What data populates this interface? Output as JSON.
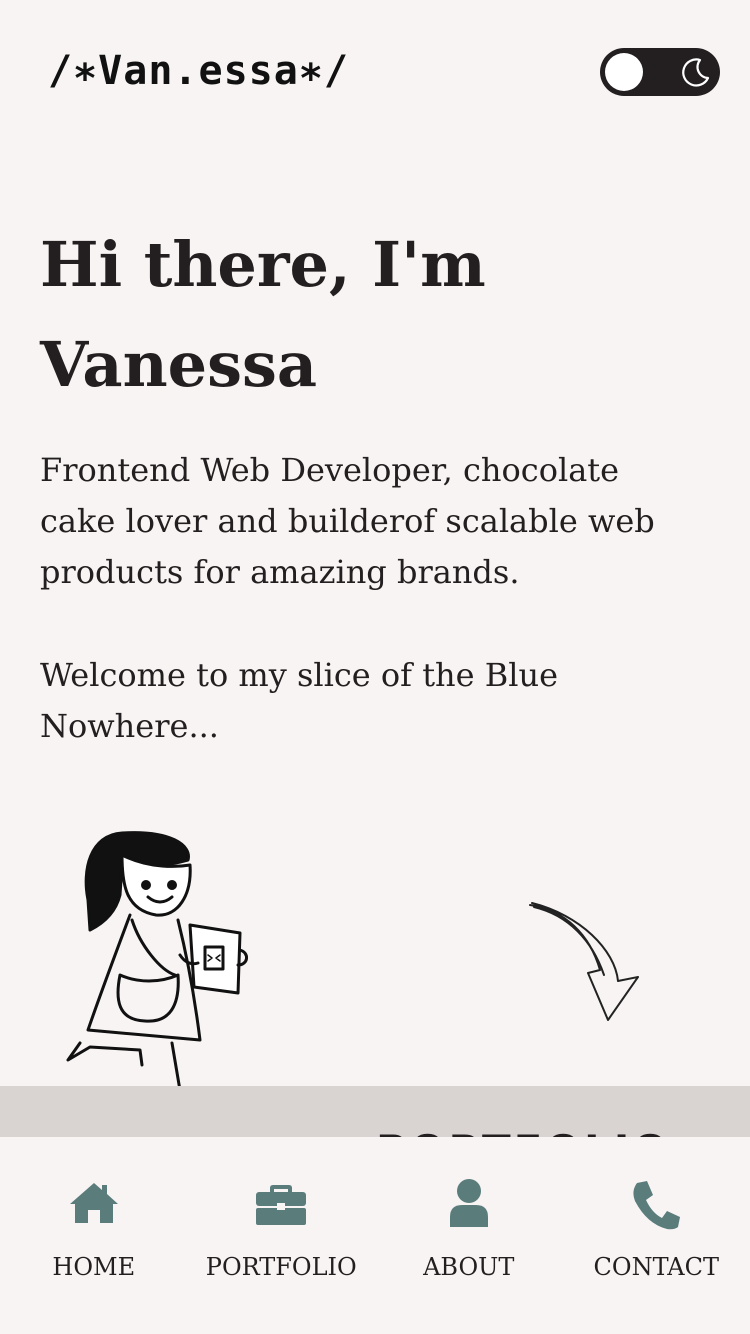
{
  "header": {
    "logo_text": "/∗Van.essa∗/",
    "theme_toggle": {
      "state": "dark-mode-off",
      "icon": "moon-icon"
    }
  },
  "hero": {
    "title": "Hi there, I'm Vanessa",
    "intro": "Frontend Web Developer, chocolate cake lover and builderof scalable web products for amazing brands.",
    "welcome": "Welcome to my slice of the Blue Nowhere..."
  },
  "illustrations": {
    "character": "girl-holding-html-tablet",
    "arrow": "hand-drawn-arrow-down"
  },
  "section_band": {
    "title": "PORTFOLIO"
  },
  "bottom_nav": [
    {
      "label": "HOME",
      "icon": "home-icon"
    },
    {
      "label": "PORTFOLIO",
      "icon": "briefcase-icon"
    },
    {
      "label": "ABOUT",
      "icon": "user-icon"
    },
    {
      "label": "CONTACT",
      "icon": "phone-icon"
    }
  ],
  "colors": {
    "background": "#f7f4f3",
    "text": "#231f20",
    "nav_icon": "#5a7d7c",
    "band": "#d9d3d2"
  }
}
